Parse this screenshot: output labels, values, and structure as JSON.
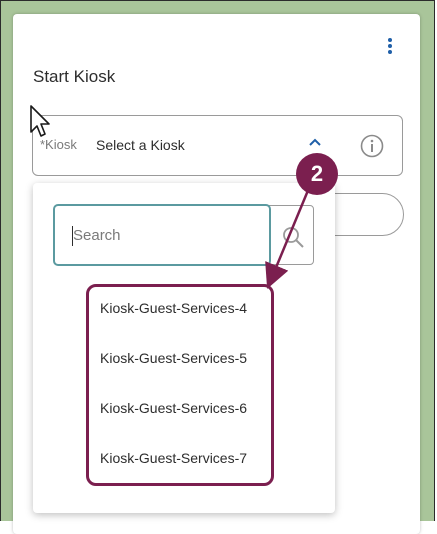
{
  "panel": {
    "title": "Start Kiosk",
    "menu_icon": "kebab-vertical-icon"
  },
  "kiosk_select": {
    "required_label": "*Kiosk",
    "value": "Select a Kiosk",
    "chevron_icon": "chevron-up-icon",
    "info_icon": "info-icon"
  },
  "dropdown": {
    "search_placeholder": "Search",
    "search_icon": "search-icon",
    "items": [
      "Kiosk-Guest-Services-4",
      "Kiosk-Guest-Services-5",
      "Kiosk-Guest-Services-6",
      "Kiosk-Guest-Services-7"
    ]
  },
  "callout": {
    "number": "2"
  },
  "colors": {
    "accent_blue": "#1f5fa8",
    "callout": "#7b1f4f",
    "focus_border": "#5b9aa0",
    "backdrop_green": "#a9c59a"
  }
}
